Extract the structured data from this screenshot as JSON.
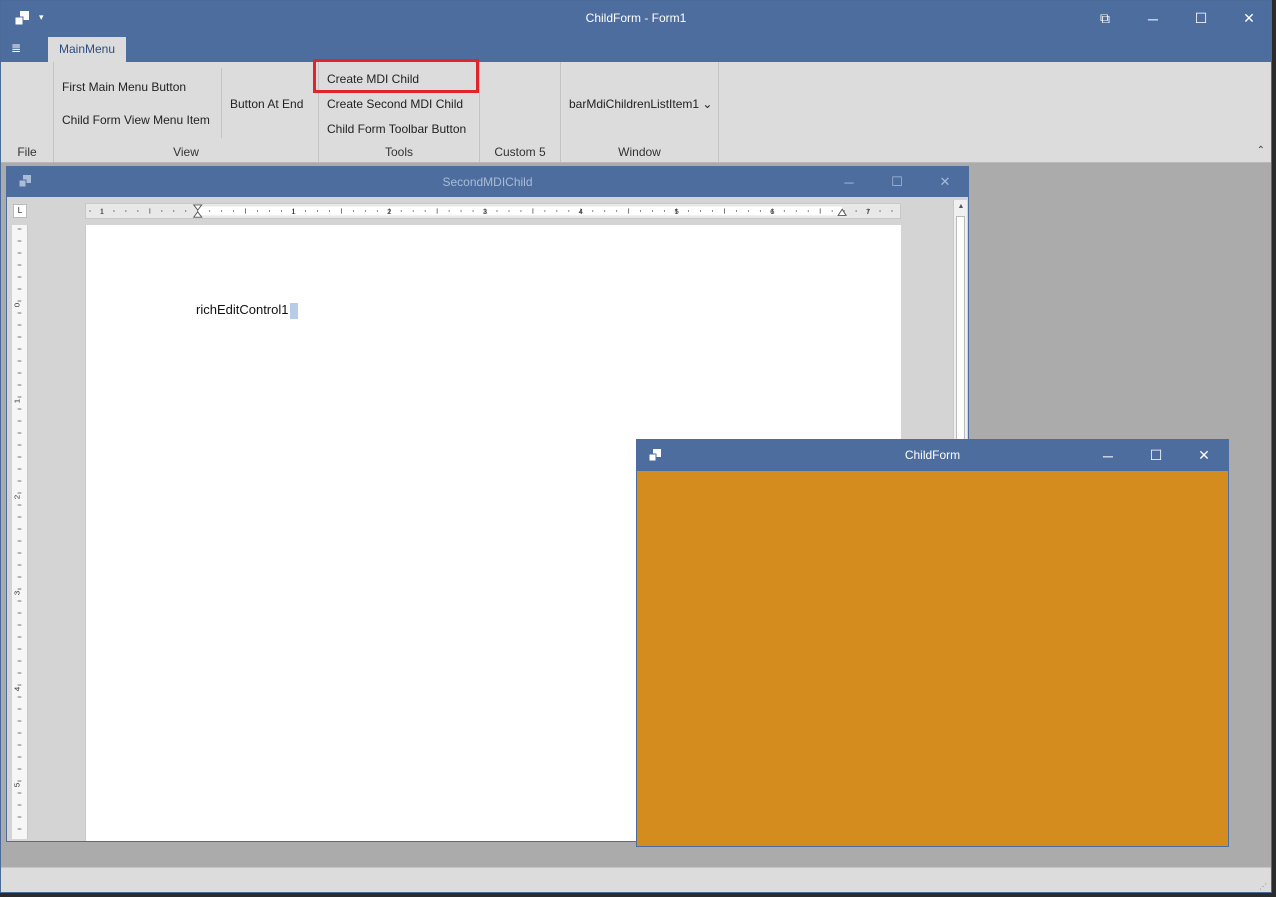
{
  "window": {
    "title": "ChildForm - Form1",
    "minimize": "─",
    "maximize": "☐",
    "close": "✕",
    "restore": "⧉",
    "qa_arrow": "▾"
  },
  "ribbon": {
    "file_menu_icon": "≣",
    "tab_label": "MainMenu",
    "groups": {
      "file": "File",
      "view": "View",
      "tools": "Tools",
      "custom5": "Custom 5",
      "window": "Window"
    },
    "buttons": {
      "first_main_menu": "First Main Menu Button",
      "child_form_view_menu": "Child Form View Menu Item",
      "button_at_end": "Button At End",
      "create_mdi_child": "Create MDI Child",
      "create_second_mdi_child": "Create Second MDI Child",
      "child_form_toolbar": "Child Form Toolbar Button",
      "bar_mdi_children": "barMdiChildrenListItem1",
      "dropdown_arrow": "⌄"
    },
    "collapse": "⌃"
  },
  "child1": {
    "title": "SecondMDIChild",
    "minimize": "─",
    "maximize": "☐",
    "close": "✕",
    "content": "richEditControl1",
    "ruler_corner": "L",
    "ruler_numbers": [
      "1",
      "1",
      "2",
      "3",
      "4",
      "5",
      "6",
      "7"
    ],
    "vruler_numbers": [
      "0",
      "1",
      "2",
      "3",
      "4",
      "5"
    ],
    "scroll_up": "▲"
  },
  "child2": {
    "title": "ChildForm",
    "minimize": "─",
    "maximize": "☐",
    "close": "✕",
    "background": "#d48c1e"
  },
  "statusbar": {
    "grip": "⋰"
  },
  "colors": {
    "title_blue": "#4d6d9e",
    "ribbon_bg": "#dcdcdc",
    "mdi_bg": "#ababab",
    "highlight_red": "#e2232a",
    "orange": "#d48c1e"
  }
}
